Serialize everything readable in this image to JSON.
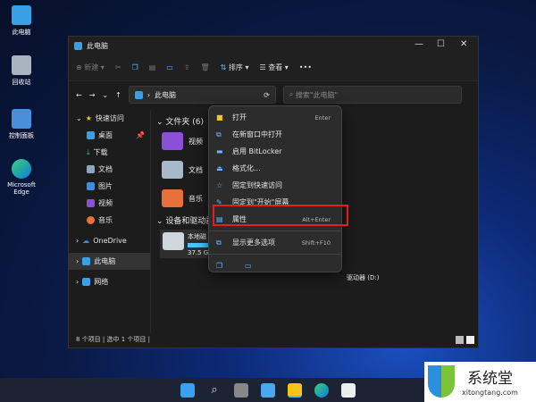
{
  "desktop": {
    "icons": [
      "此电脑",
      "回收站",
      "控制面板",
      "Microsoft Edge"
    ]
  },
  "window": {
    "title": "此电脑",
    "minimize": "—",
    "maximize": "☐",
    "close": "✕"
  },
  "toolbar": {
    "new": "新建",
    "sort": "排序",
    "view": "查看",
    "more": "•••"
  },
  "address": {
    "path": "此电脑",
    "search_placeholder": "搜索\"此电脑\""
  },
  "sidebar": {
    "quick_access": "快速访问",
    "items": [
      "桌面",
      "下载",
      "文档",
      "图片",
      "视频",
      "音乐"
    ],
    "onedrive": "OneDrive",
    "this_pc": "此电脑",
    "network": "网络"
  },
  "content": {
    "folders_header": "文件夹 (6)",
    "folders": [
      "视频",
      "文档",
      "音乐"
    ],
    "devices_header": "设备和驱动器",
    "drive_name": "本地磁",
    "drive_size": "37.5 G",
    "drive_d": "驱动器 (D:)"
  },
  "status": "8 个项目  |  选中 1 个项目  |",
  "menu": {
    "items": [
      {
        "label": "打开",
        "shortcut": "Enter"
      },
      {
        "label": "在新窗口中打开",
        "shortcut": ""
      },
      {
        "label": "启用 BitLocker",
        "shortcut": ""
      },
      {
        "label": "格式化...",
        "shortcut": ""
      },
      {
        "label": "固定到快速访问",
        "shortcut": ""
      },
      {
        "label": "固定到\"开始\"屏幕",
        "shortcut": ""
      },
      {
        "label": "属性",
        "shortcut": "Alt+Enter"
      },
      {
        "label": "显示更多选项",
        "shortcut": "Shift+F10"
      }
    ]
  },
  "watermark": {
    "brand": "系统堂",
    "url": "xitongtang.com"
  },
  "colors": {
    "accent": "#4cc2ff",
    "highlight": "#e12020"
  }
}
